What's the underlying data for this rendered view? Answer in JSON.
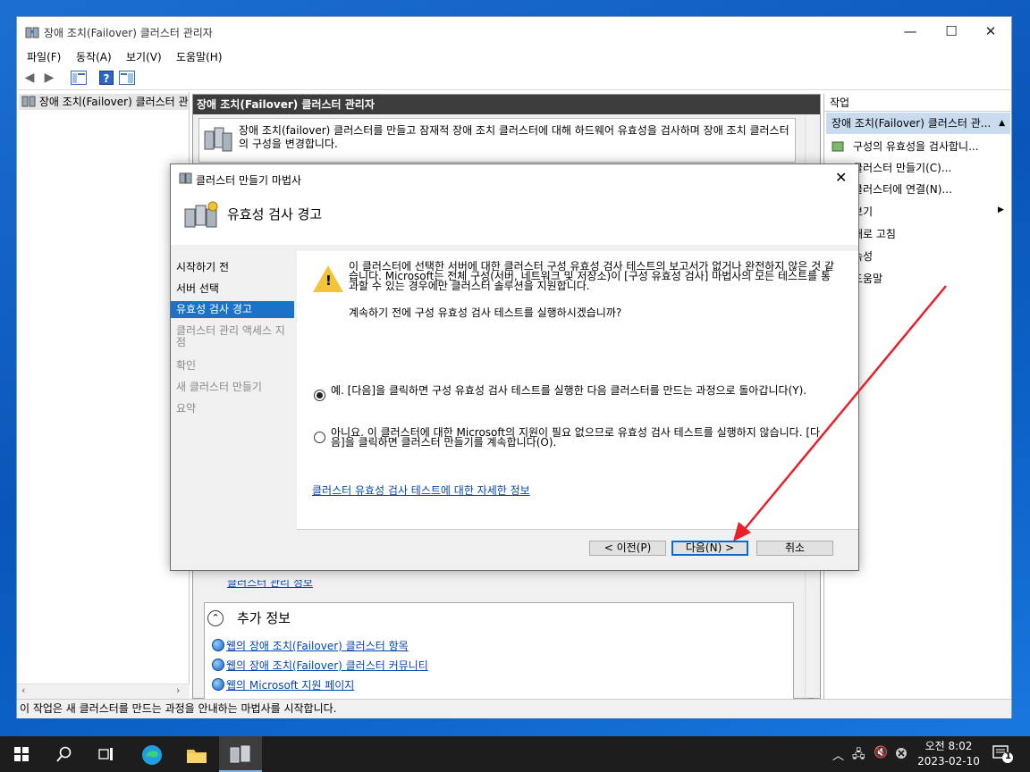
{
  "window": {
    "title": "장애 조치(Failover) 클러스터 관리자",
    "minimize": "—",
    "maximize": "☐",
    "close": "✕"
  },
  "menu": [
    "파일(F)",
    "동작(A)",
    "보기(V)",
    "도움말(H)"
  ],
  "tree": {
    "root_label": "장애 조치(Failover) 클러스터 관"
  },
  "center": {
    "header": "장애 조치(Failover) 클러스터 관리자",
    "description": "장애 조치(failover) 클러스터를 만들고 잠재적 장애 조치 클러스터에 대해 하드웨어 유효성을 검사하며 장애 조치 클러스터의 구성을 변경합니다.",
    "partial_link": "클러스터 관리 정보",
    "more_info_title": "추가 정보",
    "links": [
      "웹의 장애 조치(Failover) 클러스터 항목",
      "웹의 장애 조치(Failover) 클러스터 커뮤니티",
      "웹의 Microsoft 지원 페이지"
    ]
  },
  "actions": {
    "header": "작업",
    "section": "장애 조치(Failover) 클러스터 관...",
    "items": [
      "구성의 유효성을 검사합니...",
      "클러스터 만들기(C)...",
      "클러스터에 연결(N)...",
      "보기",
      "새로 고침",
      "속성",
      "도움말"
    ]
  },
  "status": {
    "text": "이 작업은 새 클러스터를 만드는 과정을 안내하는 마법사를 시작합니다."
  },
  "wizard": {
    "title": "클러스터 만들기 마법사",
    "heading": "유효성 검사 경고",
    "steps": [
      "시작하기 전",
      "서버 선택",
      "유효성 검사 경고",
      "클러스터 관리 액세스 지점",
      "확인",
      "새 클러스터 만들기",
      "요약"
    ],
    "active_step": 2,
    "warning_text": "이 클러스터에 선택한 서버에 대한 클러스터 구성 유효성 검사 테스트의 보고서가 없거나 완전하지 않은 것 같습니다. Microsoft는 전체 구성(서버, 네트워크 및 저장소)이 [구성 유효성 검사] 마법사의 모든 테스트를 통과할 수 있는 경우에만 클러스터 솔루션을 지원합니다.",
    "question": "계속하기 전에 구성 유효성 검사 테스트를 실행하시겠습니까?",
    "option_yes": "예. [다음]을 클릭하면 구성 유효성 검사 테스트를 실행한 다음 클러스터를 만드는 과정으로 돌아갑니다(Y).",
    "option_no": "아니요. 이 클러스터에 대한 Microsoft의 지원이 필요 없으므로 유효성 검사 테스트를 실행하지 않습니다. [다음]을 클릭하면 클러스터 만들기를 계속합니다(O).",
    "selected_option": "yes",
    "more_link": "클러스터 유효성 검사 테스트에 대한 자세한 정보",
    "btn_back": "< 이전(P)",
    "btn_next": "다음(N) >",
    "btn_cancel": "취소"
  },
  "taskbar": {
    "clock_time": "오전 8:02",
    "clock_date": "2023-02-10",
    "notification_count": "1"
  },
  "colors": {
    "accent": "#1a73c9",
    "annotation_arrow": "#e8202a"
  }
}
